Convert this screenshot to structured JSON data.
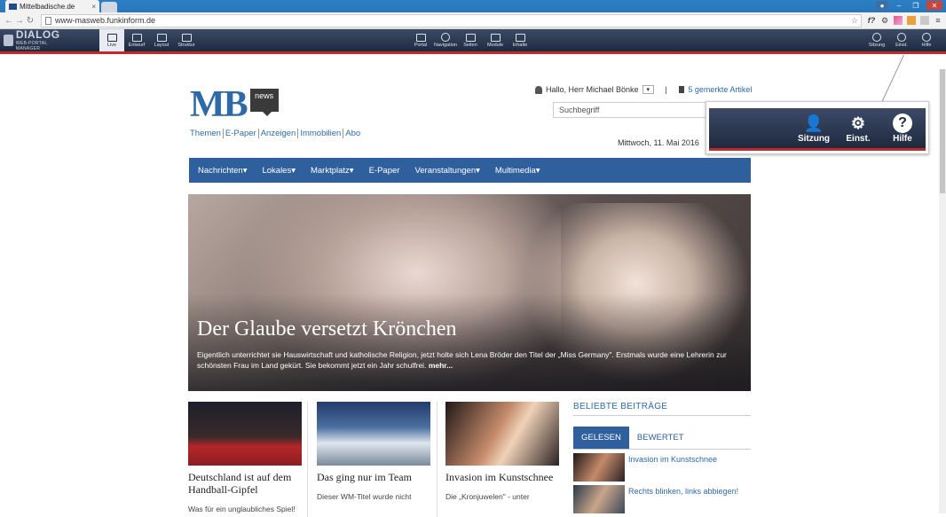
{
  "browser": {
    "tab_title": "Mittelbadische.de",
    "tab_close": "×",
    "url": "www-masweb.funkinform.de"
  },
  "cms": {
    "logo_title": "DIALOG",
    "logo_subtitle": "WEB-PORTAL MANAGER",
    "left_tools": [
      "Live",
      "Entwurf",
      "Layout",
      "Struktur"
    ],
    "center_tools": [
      "Portal",
      "Navigation",
      "Seiten",
      "Module",
      "Inhalte"
    ],
    "right_tools": [
      "Sitzung",
      "Einst.",
      "Hilfe"
    ]
  },
  "site": {
    "logo_mb": "MB",
    "logo_news": "news",
    "top_links": [
      "Themen",
      "E-Paper",
      "Anzeigen",
      "Immobilien",
      "Abo"
    ],
    "greeting": "Hallo, Herr Michael Bönke",
    "separator": "|",
    "bookmarks": "5 gemerkte Artikel",
    "search_placeholder": "Suchbegriff",
    "date": "Mittwoch, 11. Mai 2016",
    "nav": [
      "Nachrichten▾",
      "Lokales▾",
      "Marktplatz▾",
      "E-Paper",
      "Veranstaltungen▾",
      "Multimedia▾"
    ]
  },
  "hero": {
    "title": "Der Glaube versetzt Krönchen",
    "text": "Eigentlich unterrichtet sie Hauswirtschaft und katholische Religion, jetzt holte sich Lena Bröder den Titel der „Miss Germany\". Erstmals wurde eine Lehrerin zur schönsten Frau im Land gekürt. Sie bekommt jetzt ein Jahr schulfrei.",
    "more": "mehr..."
  },
  "cards": [
    {
      "title": "Deutschland ist auf dem Handball-Gipfel",
      "teaser": "Was für ein unglaubliches Spiel!"
    },
    {
      "title": "Das ging nur im Team",
      "teaser": "Dieser WM-Titel wurde nicht"
    },
    {
      "title": "Invasion im Kunstschnee",
      "teaser": "Die „Kronjuwelen\" - unter"
    }
  ],
  "sidebar": {
    "heading": "BELIEBTE BEITRÄGE",
    "tab_active": "GELESEN",
    "tab_other": "BEWERTET",
    "items": [
      "Invasion im Kunstschnee",
      "Rechts blinken, links abbiegen!"
    ]
  },
  "popup": {
    "session": "Sitzung",
    "settings": "Einst.",
    "help": "Hilfe",
    "help_glyph": "?"
  },
  "colors": {
    "brand_blue": "#2f5f9d",
    "cms_dark": "#1f2a3f",
    "cms_red": "#c0292b"
  }
}
